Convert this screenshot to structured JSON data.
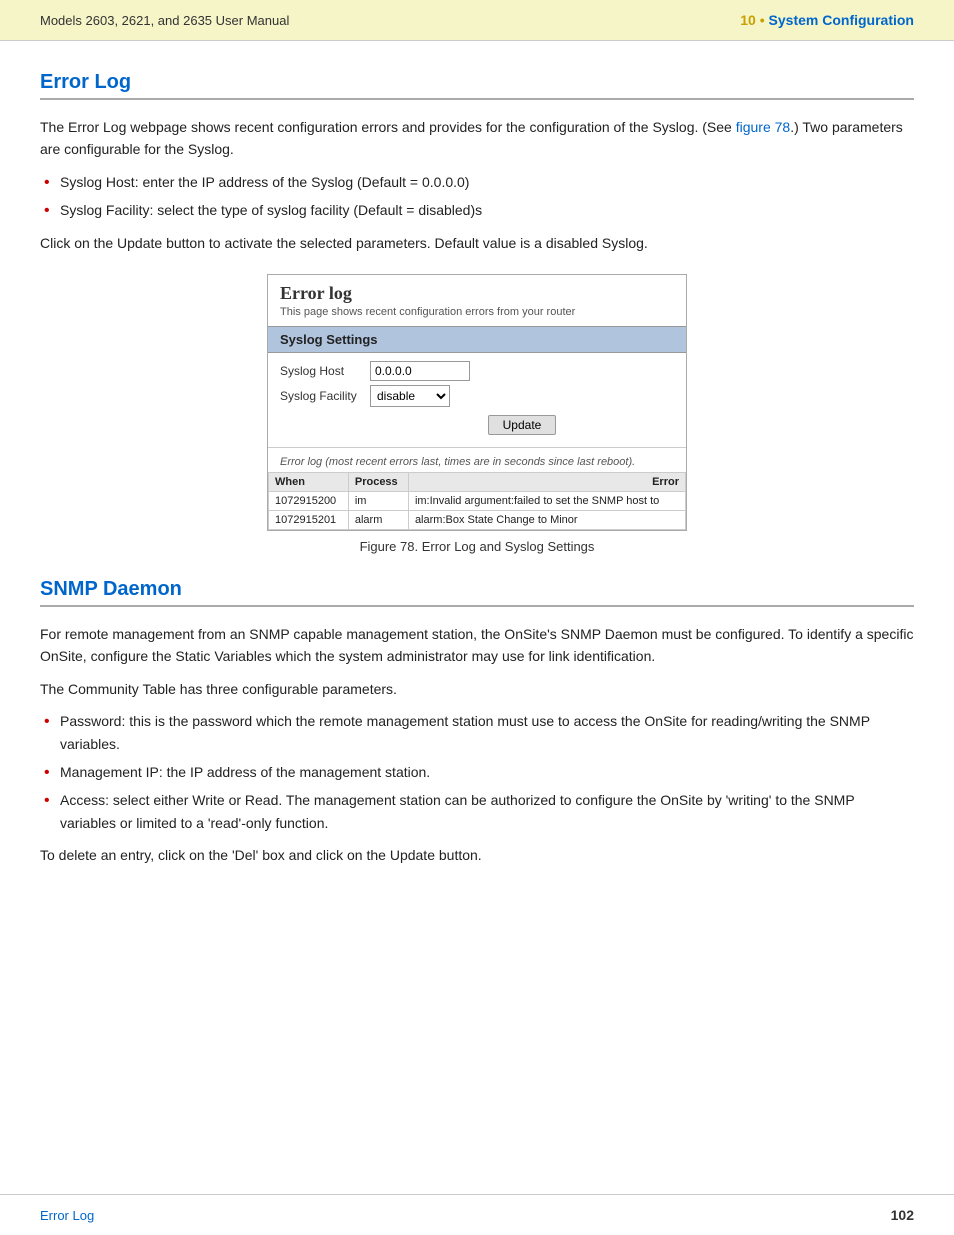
{
  "header": {
    "left_text": "Models 2603, 2621, and 2635 User Manual",
    "chapter_num": "10 • ",
    "chapter_title": "System Configuration"
  },
  "error_log_section": {
    "heading": "Error Log",
    "intro_text": "The Error Log webpage shows recent configuration errors and provides for the configuration of the Syslog. (See ",
    "figure_link": "figure 78",
    "intro_text2": ".) Two parameters are configurable for the Syslog.",
    "bullets": [
      "Syslog Host: enter the IP address of the Syslog (Default = 0.0.0.0)",
      "Syslog Facility: select the type of syslog facility (Default = disabled)s"
    ],
    "click_text": "Click on the Update button to activate the selected parameters. Default value is a disabled Syslog.",
    "widget": {
      "title": "Error log",
      "subtitle": "This page shows recent configuration errors from your router",
      "syslog_header": "Syslog Settings",
      "syslog_host_label": "Syslog Host",
      "syslog_host_value": "0.0.0.0",
      "syslog_facility_label": "Syslog Facility",
      "syslog_facility_value": "disable",
      "update_button": "Update",
      "log_note": "Error log (most recent errors last, times are in seconds since last reboot).",
      "table_headers": [
        "When",
        "Process",
        "Error"
      ],
      "table_rows": [
        {
          "when": "1072915200",
          "process": "im",
          "error": "im:Invalid argument:failed to set the SNMP host to"
        },
        {
          "when": "1072915201",
          "process": "alarm",
          "error": "alarm:Box State Change to Minor"
        }
      ]
    },
    "figure_caption": "Figure 78. Error Log and Syslog Settings"
  },
  "snmp_daemon_section": {
    "heading": "SNMP Daemon",
    "intro_text": "For remote management from an SNMP capable management station, the OnSite's SNMP Daemon must be configured. To identify a specific OnSite, configure the Static Variables which the system administrator may use for link identification.",
    "community_text": "The Community Table has three configurable parameters.",
    "bullets": [
      "Password: this is the password which the remote management station must use to access the OnSite for reading/writing the SNMP variables.",
      "Management IP: the IP address of the management station.",
      "Access: select either Write or Read. The management station can be authorized to configure the OnSite by 'writing' to the SNMP variables or limited to a 'read'-only function."
    ],
    "delete_text": "To delete an entry, click on the 'Del' box and click on the Update button."
  },
  "footer": {
    "left_text": "Error Log",
    "page_number": "102"
  }
}
